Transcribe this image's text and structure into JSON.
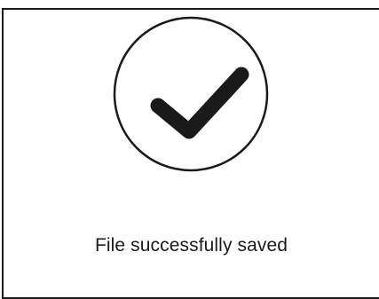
{
  "dialog": {
    "icon": "checkmark-circle-icon",
    "message": "File successfully saved"
  },
  "colors": {
    "stroke": "#1a1a1a",
    "background": "#ffffff"
  }
}
